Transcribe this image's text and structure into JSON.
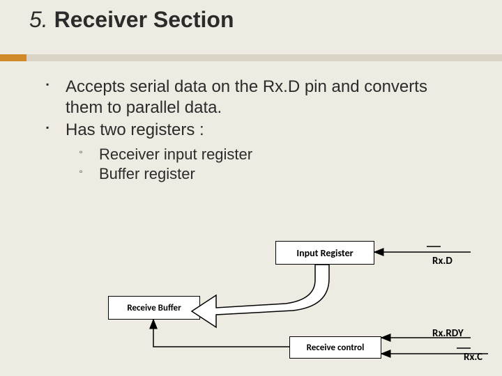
{
  "title": {
    "num": "5.",
    "text": "Receiver Section"
  },
  "bullets": {
    "b1": "Accepts serial data on the Rx.D pin and converts them to parallel data.",
    "b2": "Has two registers :",
    "sub1": "Receiver input register",
    "sub2": "Buffer register"
  },
  "diagram": {
    "input_register": "Input Register",
    "receive_buffer": "Receive Buffer",
    "receive_control": "Receive control",
    "rxd": "Rx.D",
    "rxrdy": "Rx.RDY",
    "rxc": "Rx.C"
  }
}
